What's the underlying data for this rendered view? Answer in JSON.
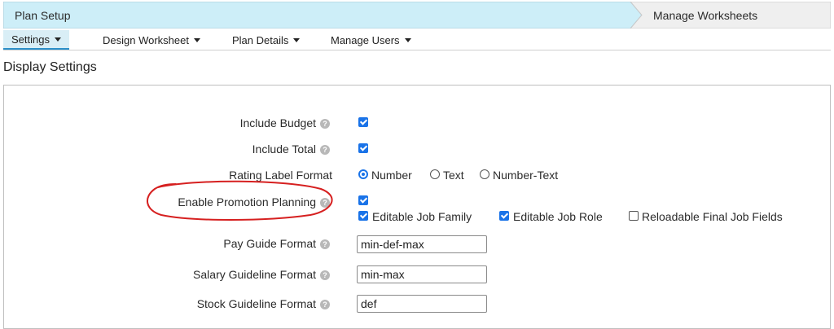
{
  "stepbar": {
    "active_step": "Plan Setup",
    "next_step": "Manage Worksheets"
  },
  "subnav": {
    "items": [
      {
        "label": "Settings"
      },
      {
        "label": "Design Worksheet"
      },
      {
        "label": "Plan Details"
      },
      {
        "label": "Manage Users"
      }
    ]
  },
  "section_title": "Display Settings",
  "form": {
    "include_budget": {
      "label": "Include Budget",
      "checked": true
    },
    "include_total": {
      "label": "Include Total",
      "checked": true
    },
    "rating_label_format": {
      "label": "Rating Label Format",
      "options": [
        "Number",
        "Text",
        "Number-Text"
      ],
      "selected": "Number"
    },
    "enable_promotion_planning": {
      "label": "Enable Promotion Planning",
      "checked": true,
      "sub_options": [
        {
          "label": "Editable Job Family",
          "checked": true
        },
        {
          "label": "Editable Job Role",
          "checked": true
        },
        {
          "label": "Reloadable Final Job Fields",
          "checked": false
        }
      ]
    },
    "pay_guide_format": {
      "label": "Pay Guide Format",
      "value": "min-def-max"
    },
    "salary_guideline_format": {
      "label": "Salary Guideline Format",
      "value": "min-max"
    },
    "stock_guideline_format": {
      "label": "Stock Guideline Format",
      "value": "def"
    }
  },
  "colors": {
    "step_active": "#cdeef8",
    "step_inactive": "#efefef",
    "accent": "#1a73e8",
    "annotation": "#d62020"
  },
  "icons": {
    "help": "question-circle-icon",
    "dropdown": "caret-down-icon"
  }
}
